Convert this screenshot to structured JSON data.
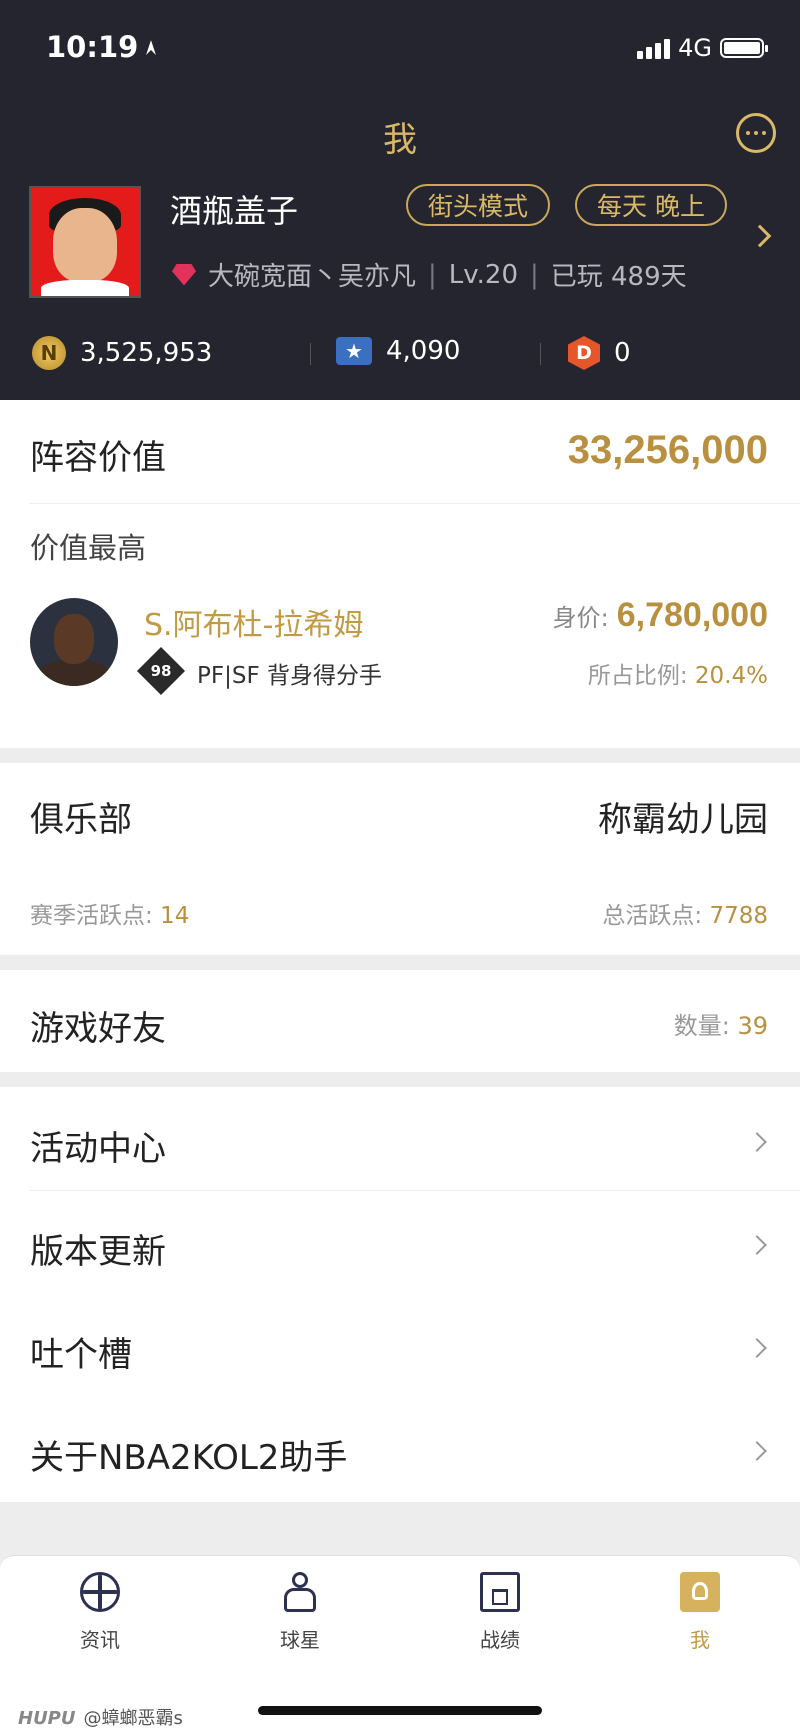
{
  "status_bar": {
    "time": "10:19",
    "network": "4G"
  },
  "header": {
    "title": "我"
  },
  "profile": {
    "username": "酒瓶盖子",
    "tags": [
      "街头模式",
      "每天 晚上"
    ],
    "team": "大碗宽面丶吴亦凡",
    "level": "Lv.20",
    "played": "已玩 489天"
  },
  "currencies": [
    {
      "icon": "n-coin-icon",
      "value": "3,525,953"
    },
    {
      "icon": "star-ticket-icon",
      "value": "4,090"
    },
    {
      "icon": "d-coin-icon",
      "value": "0"
    }
  ],
  "lineup": {
    "label": "阵容价值",
    "value": "33,256,000",
    "top_label": "价值最高",
    "player": {
      "name": "S.阿布杜-拉希姆",
      "rating": "98",
      "position": "PF|SF 背身得分手",
      "worth_label": "身价:",
      "worth": "6,780,000",
      "share_label": "所占比例:",
      "share": "20.4%"
    }
  },
  "club": {
    "label": "俱乐部",
    "name": "称霸幼儿园",
    "season_label": "赛季活跃点:",
    "season_value": "14",
    "total_label": "总活跃点:",
    "total_value": "7788"
  },
  "friends": {
    "label": "游戏好友",
    "count_label": "数量:",
    "count": "39"
  },
  "menu": [
    {
      "label": "活动中心"
    },
    {
      "label": "版本更新"
    },
    {
      "label": "吐个槽"
    },
    {
      "label": "关于NBA2KOL2助手"
    }
  ],
  "tabs": [
    {
      "label": "资讯",
      "icon": "basketball-icon"
    },
    {
      "label": "球星",
      "icon": "player-icon"
    },
    {
      "label": "战绩",
      "icon": "backboard-icon"
    },
    {
      "label": "我",
      "icon": "me-icon"
    }
  ],
  "watermark": {
    "brand": "HUPU",
    "user": "@蟑螂恶霸s"
  },
  "colors": {
    "gold": "#b8903f",
    "header_bg": "#25252f"
  }
}
